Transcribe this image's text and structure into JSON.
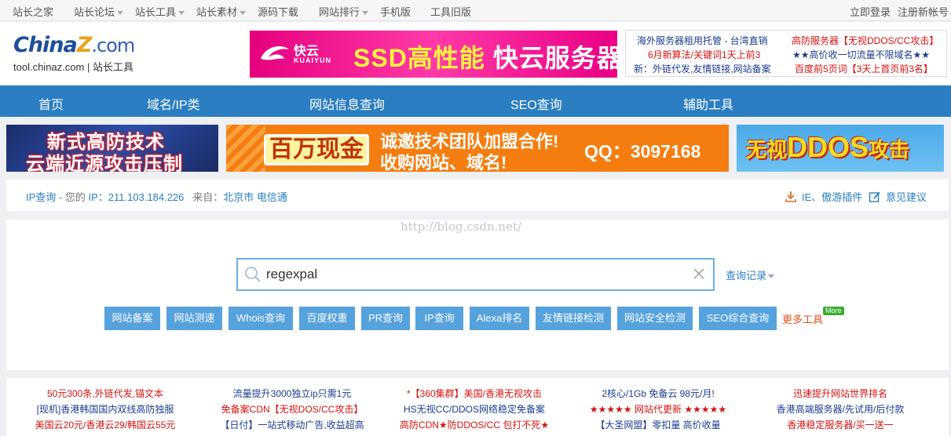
{
  "topbar": {
    "items": [
      "站长之家",
      "站长论坛",
      "站长工具",
      "站长素材",
      "源码下载",
      "网站排行",
      "手机版",
      "工具旧版"
    ],
    "login": "立即登录",
    "register": "注册新帐号"
  },
  "logo": {
    "brand_a": "China",
    "brand_z": "Z",
    "brand_com": ".com",
    "domain": "tool.chinaz.com",
    "divider": "|",
    "site": "站长工具"
  },
  "top_ad": {
    "logo_cn": "快云",
    "logo_en": "KUAIYUN",
    "slogan_a": "SSD高性能",
    "slogan_b": "快云服务器"
  },
  "text_links": [
    {
      "text": "海外服务器租用托管 - 台湾直销",
      "color": "blue"
    },
    {
      "text": "高防服务器【无视DDOS/CC攻击】",
      "color": "red"
    },
    {
      "text": "6月新算法/关键词1天上前3",
      "color": "red"
    },
    {
      "text": "★★高价收一切流量不限域名★★",
      "color": "blue"
    },
    {
      "text": "新：外链代发,友情链接,网站备案",
      "color": "blue"
    },
    {
      "text": "百度前5页词【3天上首页前3名】",
      "color": "red"
    }
  ],
  "mainnav": [
    "首页",
    "域名/IP类",
    "网站信息查询",
    "SEO查询",
    "辅助工具"
  ],
  "banners": {
    "b1_line1": "新式高防技术",
    "b1_line2": "云端近源攻击压制",
    "b2_money": "百万现金",
    "b2_line1": "诚邀技术团队加盟合作!",
    "b2_line2": "收购网站、域名!",
    "b2_qq": "QQ：3097168",
    "b3_text_a": "无视",
    "b3_text_b": "DDOS",
    "b3_text_c": "攻击"
  },
  "infobar": {
    "ip_query": "IP查询",
    "sep": " - 您的 ",
    "ip_label": "IP：",
    "ip_value": "211.103.184.226",
    "from_label": "来自：",
    "from_value": "北京市 电信通",
    "plugin": "IE、傲游插件",
    "feedback": "意见建议"
  },
  "search": {
    "watermark": "http://blog.csdn.net/",
    "value": "regexpal",
    "history": "查询记录"
  },
  "tools": [
    "网站备案",
    "网站测速",
    "Whois查询",
    "百度权重",
    "PR查询",
    "IP查询",
    "Alexa排名",
    "友情链接检测",
    "网站安全检测",
    "SEO综合查询"
  ],
  "more_tools": "更多工具",
  "more_badge": "More",
  "adgrid": [
    [
      {
        "t": "50元300条,外链代发,锚文本",
        "c": "red"
      },
      {
        "t": "[现机]香港韩国国内双线高防独服",
        "c": "blue"
      },
      {
        "t": "美国云20元/香港云29/韩国云55元",
        "c": "red"
      }
    ],
    [
      {
        "t": "流量提升3000独立ip只需1元",
        "c": "blue"
      },
      {
        "t": "免备案CDN【无视DOS/CC攻击】",
        "c": "red"
      },
      {
        "t": "【日付】一站式移动广告,收益超高",
        "c": "blue"
      }
    ],
    [
      {
        "t": "*【360集群】美国/香港无视攻击",
        "c": "red"
      },
      {
        "t": "HS无视CC/DDOS网络稳定免备案",
        "c": "blue"
      },
      {
        "t": "高防CDN★防DDOS/CC 包打不死★",
        "c": "red"
      }
    ],
    [
      {
        "t": "2核心/1Gb 免备云 98元/月!",
        "c": "blue"
      },
      {
        "t": "★★★★★ 网站代更新 ★★★★★",
        "c": "red"
      },
      {
        "t": "【大圣网盟】零扣量 高价收量",
        "c": "blue"
      }
    ],
    [
      {
        "t": "迅速提升网站世界排名",
        "c": "red"
      },
      {
        "t": "香港高端服务器/先试用/后付款",
        "c": "blue"
      },
      {
        "t": "香港稳定服务器/买一送一",
        "c": "red"
      }
    ]
  ]
}
